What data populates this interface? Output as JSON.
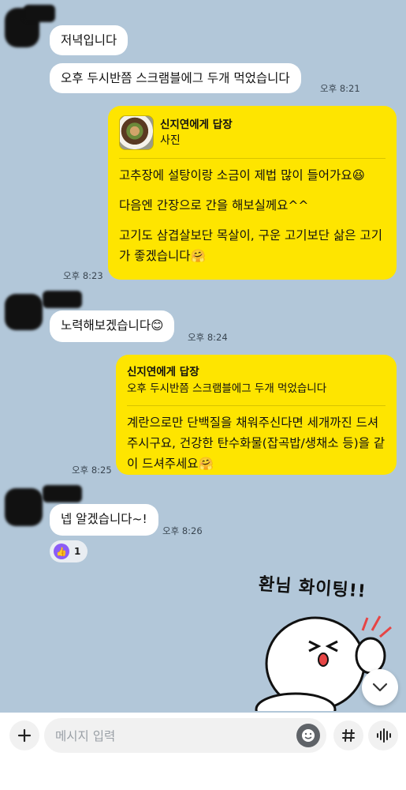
{
  "messages": {
    "m1": "저녁입니다",
    "m2": "오후 두시반쯤 스크램블에그 두개 먹었습니다",
    "m2_time": "오후 8:21",
    "m3": {
      "reply_to": "신지연에게 답장",
      "reply_preview": "사진",
      "line1": "고추장에 설탕이랑 소금이 제법 많이 들어가요😆",
      "line2": "다음엔 간장으로 간을 해보실께요^^",
      "line3": "고기도 삼겹살보단 목살이, 구운 고기보단 삶은 고기가 좋겠습니다🤗",
      "time": "오후 8:23"
    },
    "m4": "노력해보겠습니다😊",
    "m4_time": "오후 8:24",
    "m5": {
      "reply_to": "신지연에게 답장",
      "reply_quote": "오후 두시반쯤 스크램블에그 두개 먹었습니다",
      "body": "계란으로만 단백질을 채워주신다면 세개까진 드셔주시구요, 건강한 탄수화물(잡곡밥/생채소 등)을 같이 드셔주세요🤗",
      "time": "오후 8:25"
    },
    "m6": "넵 알겠습니다~!",
    "m6_time": "오후 8:26",
    "reaction_count": "1"
  },
  "sticker": {
    "text": "환님 화이팅!!"
  },
  "input": {
    "placeholder": "메시지 입력"
  },
  "colors": {
    "chat_bg": "#b2c7d9",
    "outgoing_bubble": "#fee500",
    "incoming_bubble": "#ffffff",
    "reaction_accent": "#8b5cf6"
  }
}
